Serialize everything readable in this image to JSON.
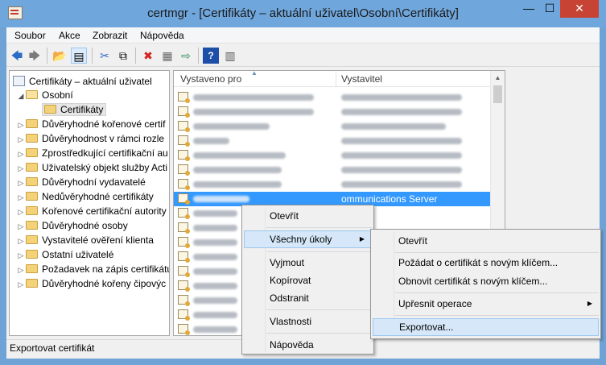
{
  "window": {
    "title": "certmgr - [Certifikáty – aktuální uživatel\\Osobní\\Certifikáty]",
    "minimize": "—",
    "maximize": "☐",
    "close": "✕"
  },
  "menubar": [
    "Soubor",
    "Akce",
    "Zobrazit",
    "Nápověda"
  ],
  "toolbar": {
    "back": "🡄",
    "forward": "🡆",
    "up": "📂",
    "show_tree": "▤",
    "cut": "✂",
    "copy": "⧉",
    "delete": "✖",
    "properties": "▦",
    "export": "⇨",
    "help": "?",
    "view": "▥"
  },
  "tree": {
    "items": [
      {
        "label": "Certifikáty – aktuální uživatel"
      },
      {
        "label": "Osobní"
      },
      {
        "label": "Certifikáty"
      },
      {
        "label": "Důvěryhodné kořenové certif"
      },
      {
        "label": "Důvěryhodnost v rámci rozle"
      },
      {
        "label": "Zprostředkující certifikační au"
      },
      {
        "label": "Uživatelský objekt služby Acti"
      },
      {
        "label": "Důvěryhodní vydavatelé"
      },
      {
        "label": "Nedůvěryhodné certifikáty"
      },
      {
        "label": "Kořenové certifikační autority"
      },
      {
        "label": "Důvěryhodné osoby"
      },
      {
        "label": "Vystavitelé ověření klienta"
      },
      {
        "label": "Ostatní uživatelé"
      },
      {
        "label": "Požadavek na zápis certifikátu"
      },
      {
        "label": "Důvěryhodné kořeny čipovýc"
      }
    ]
  },
  "list": {
    "columns": [
      "Vystaveno pro",
      "Vystavitel"
    ],
    "selected_issuer": "ommunications Server"
  },
  "context_menu": {
    "items": [
      "Otevřít",
      "Všechny úkoly",
      "Vyjmout",
      "Kopírovat",
      "Odstranit",
      "Vlastnosti",
      "Nápověda"
    ]
  },
  "submenu": {
    "items": [
      "Otevřít",
      "Požádat o certifikát s novým klíčem...",
      "Obnovit certifikát s novým klíčem...",
      "Upřesnit operace",
      "Exportovat..."
    ]
  },
  "status": "Exportovat certifikát"
}
